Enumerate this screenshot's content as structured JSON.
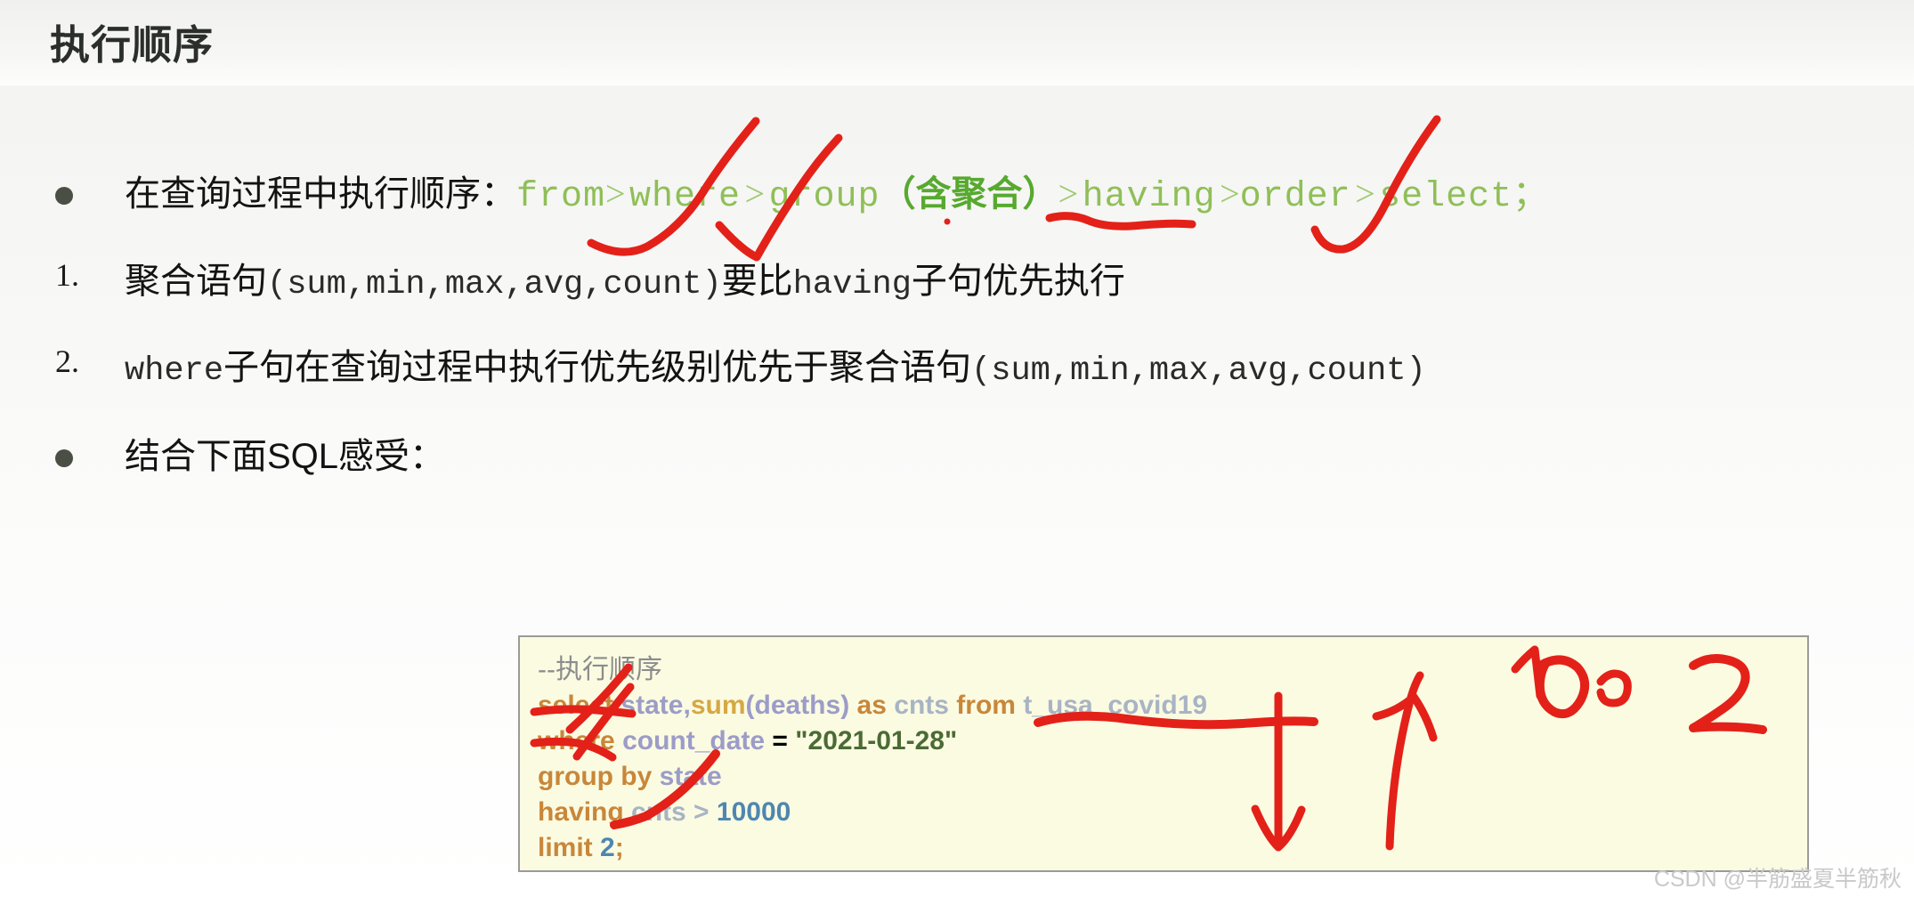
{
  "slide": {
    "title": "执行顺序",
    "background_color": "#f5f5f3"
  },
  "bullets": [
    {
      "marker": "dot",
      "prefix_cn": "在查询过程中执行顺序：",
      "sequence": [
        {
          "text": "from",
          "style": "keyword"
        },
        {
          "text": ">",
          "style": "arrow"
        },
        {
          "text": "where",
          "style": "keyword"
        },
        {
          "text": ">",
          "style": "arrow"
        },
        {
          "text": "group",
          "style": "keyword"
        },
        {
          "text": "（含聚合）",
          "style": "keyword-strong"
        },
        {
          "text": ">",
          "style": "arrow"
        },
        {
          "text": "having",
          "style": "keyword"
        },
        {
          "text": ">",
          "style": "arrow"
        },
        {
          "text": "order",
          "style": "keyword"
        },
        {
          "text": ">",
          "style": "arrow"
        },
        {
          "text": "select；",
          "style": "keyword"
        }
      ]
    },
    {
      "marker": "1.",
      "text_a": "聚合语句",
      "text_b": "(sum,min,max,avg,count)",
      "text_c": "要比",
      "text_d": "having",
      "text_e": "子句优先执行"
    },
    {
      "marker": "2.",
      "text_a": "where",
      "text_b": "子句在查询过程中执行优先级别优先于聚合语句",
      "text_c": "(sum,min,max,avg,count)"
    },
    {
      "marker": "dot",
      "text": "结合下面SQL感受："
    }
  ],
  "code_block": {
    "background_color": "#fbfbe2",
    "border_color": "#9a9a9a",
    "lines": [
      [
        {
          "t": "--执行顺序",
          "c": "comment"
        }
      ],
      [
        {
          "t": "select",
          "c": "kw"
        },
        {
          "t": " ",
          "c": "plain"
        },
        {
          "t": "state",
          "c": "col"
        },
        {
          "t": ",",
          "c": "punct"
        },
        {
          "t": "sum",
          "c": "fn"
        },
        {
          "t": "(",
          "c": "col"
        },
        {
          "t": "deaths",
          "c": "col"
        },
        {
          "t": ")",
          "c": "col"
        },
        {
          "t": " ",
          "c": "plain"
        },
        {
          "t": "as",
          "c": "kw"
        },
        {
          "t": " ",
          "c": "plain"
        },
        {
          "t": "cnts",
          "c": "id"
        },
        {
          "t": " ",
          "c": "plain"
        },
        {
          "t": "from",
          "c": "kw"
        },
        {
          "t": " ",
          "c": "plain"
        },
        {
          "t": "t_usa_covid19",
          "c": "tbl"
        }
      ],
      [
        {
          "t": "where",
          "c": "kw"
        },
        {
          "t": " ",
          "c": "plain"
        },
        {
          "t": "count_date",
          "c": "col"
        },
        {
          "t": " = ",
          "c": "plain"
        },
        {
          "t": "\"2021-01-28\"",
          "c": "str"
        }
      ],
      [
        {
          "t": "group by",
          "c": "kw"
        },
        {
          "t": " ",
          "c": "plain"
        },
        {
          "t": "state",
          "c": "col"
        }
      ],
      [
        {
          "t": "having",
          "c": "kw"
        },
        {
          "t": " ",
          "c": "plain"
        },
        {
          "t": "cnts",
          "c": "id"
        },
        {
          "t": " > ",
          "c": "id"
        },
        {
          "t": "10000",
          "c": "num"
        }
      ],
      [
        {
          "t": "limit",
          "c": "kw"
        },
        {
          "t": " ",
          "c": "plain"
        },
        {
          "t": "2",
          "c": "num"
        },
        {
          "t": ";",
          "c": "kw"
        }
      ]
    ]
  },
  "annotations": {
    "ink_color": "#e32119",
    "marks": [
      {
        "name": "check-from",
        "kind": "check"
      },
      {
        "name": "check-where",
        "kind": "check"
      },
      {
        "name": "underline-hanjuhe",
        "kind": "underline"
      },
      {
        "name": "check-having",
        "kind": "check"
      },
      {
        "name": "underline-select",
        "kind": "underline"
      },
      {
        "name": "check-select",
        "kind": "check"
      },
      {
        "name": "underline-where",
        "kind": "underline"
      },
      {
        "name": "check-where-code",
        "kind": "check"
      },
      {
        "name": "underline-table",
        "kind": "underline"
      },
      {
        "name": "check-having-code",
        "kind": "check"
      },
      {
        "name": "arrow-down",
        "kind": "arrow"
      },
      {
        "name": "arrow-up",
        "kind": "arrow"
      },
      {
        "name": "handwritten-100",
        "kind": "text",
        "text": "100"
      },
      {
        "name": "handwritten-2",
        "kind": "text",
        "text": "2"
      }
    ]
  },
  "watermark": {
    "text": "CSDN @半筋盛夏半筋秋"
  }
}
